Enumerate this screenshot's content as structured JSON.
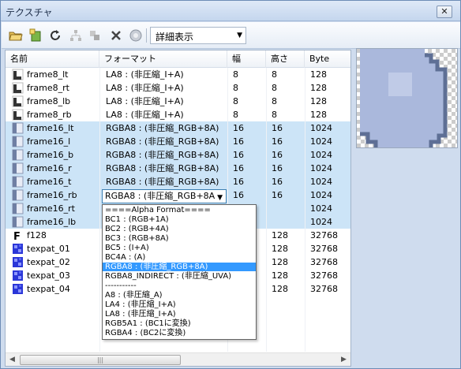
{
  "window": {
    "title": "テクスチャ",
    "close_label": "✕"
  },
  "toolbar": {
    "buttons": [
      "open-folder-icon",
      "add-texture-icon",
      "refresh-icon",
      "hierarchy-icon",
      "link-icon",
      "delete-icon",
      "settings-icon"
    ],
    "view_mode": "詳細表示"
  },
  "columns": {
    "name": "名前",
    "format": "フォーマット",
    "width": "幅",
    "height": "高さ",
    "byte": "Byte"
  },
  "rows": [
    {
      "name": "frame8_lt",
      "format": "LA8 : (非圧縮_I+A)",
      "w": "8",
      "h": "8",
      "b": "128",
      "sel": false
    },
    {
      "name": "frame8_rt",
      "format": "LA8 : (非圧縮_I+A)",
      "w": "8",
      "h": "8",
      "b": "128",
      "sel": false
    },
    {
      "name": "frame8_lb",
      "format": "LA8 : (非圧縮_I+A)",
      "w": "8",
      "h": "8",
      "b": "128",
      "sel": false
    },
    {
      "name": "frame8_rb",
      "format": "LA8 : (非圧縮_I+A)",
      "w": "8",
      "h": "8",
      "b": "128",
      "sel": false
    },
    {
      "name": "frame16_lt",
      "format": "RGBA8 : (非圧縮_RGB+8A)",
      "w": "16",
      "h": "16",
      "b": "1024",
      "sel": true
    },
    {
      "name": "frame16_l",
      "format": "RGBA8 : (非圧縮_RGB+8A)",
      "w": "16",
      "h": "16",
      "b": "1024",
      "sel": true
    },
    {
      "name": "frame16_b",
      "format": "RGBA8 : (非圧縮_RGB+8A)",
      "w": "16",
      "h": "16",
      "b": "1024",
      "sel": true
    },
    {
      "name": "frame16_r",
      "format": "RGBA8 : (非圧縮_RGB+8A)",
      "w": "16",
      "h": "16",
      "b": "1024",
      "sel": true
    },
    {
      "name": "frame16_t",
      "format": "RGBA8 : (非圧縮_RGB+8A)",
      "w": "16",
      "h": "16",
      "b": "1024",
      "sel": true
    },
    {
      "name": "frame16_rb",
      "format": "",
      "w": "16",
      "h": "16",
      "b": "1024",
      "sel": true
    },
    {
      "name": "frame16_rt",
      "format": "",
      "w": "",
      "h": "",
      "b": "1024",
      "sel": true
    },
    {
      "name": "frame16_lb",
      "format": "",
      "w": "",
      "h": "",
      "b": "1024",
      "sel": true
    },
    {
      "name": "f128",
      "format": "",
      "w": "",
      "h": "128",
      "b": "32768",
      "sel": false
    },
    {
      "name": "texpat_01",
      "format": "",
      "w": "",
      "h": "128",
      "b": "32768",
      "sel": false
    },
    {
      "name": "texpat_02",
      "format": "",
      "w": "",
      "h": "128",
      "b": "32768",
      "sel": false
    },
    {
      "name": "texpat_03",
      "format": "",
      "w": "",
      "h": "128",
      "b": "32768",
      "sel": false
    },
    {
      "name": "texpat_04",
      "format": "",
      "w": "",
      "h": "128",
      "b": "32768",
      "sel": false
    }
  ],
  "format_editor": {
    "current": "RGBA8 : (非圧縮_RGB+8A"
  },
  "format_options": [
    "====Alpha Format====",
    "BC1 : (RGB+1A)",
    "BC2 : (RGB+4A)",
    "BC3 : (RGB+8A)",
    "BC5 : (I+A)",
    "BC4A : (A)",
    "RGBA8 : (非圧縮_RGB+8A)",
    "RGBA8_INDIRECT : (非圧縮_UVA)",
    "-----------",
    "A8 : (非圧縮_A)",
    "LA4 : (非圧縮_I+A)",
    "LA8 : (非圧縮_I+A)",
    "RGB5A1 : (BC1に変換)",
    "RGBA4 : (BC2に変換)"
  ],
  "highlighted_option_index": 6,
  "scrollbar": {
    "left_arrow": "◀",
    "right_arrow": "▶",
    "grip": "|||"
  },
  "colors": {
    "selection": "#cce4f7",
    "highlight": "#3399ff",
    "texture": "#aab8dc"
  }
}
